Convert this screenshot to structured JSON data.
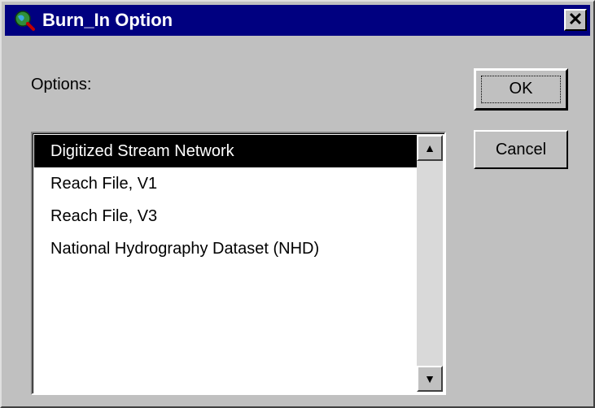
{
  "window": {
    "title": "Burn_In Option",
    "title_bar_color": "#000080",
    "icon": "globe-search-icon",
    "close_label": "✕"
  },
  "dialog": {
    "options_label": "Options:",
    "list": {
      "items": [
        {
          "label": "Digitized Stream Network",
          "selected": true
        },
        {
          "label": "Reach File, V1",
          "selected": false
        },
        {
          "label": "Reach File, V3",
          "selected": false
        },
        {
          "label": "National Hydrography Dataset (NHD)",
          "selected": false
        }
      ],
      "scroll_up_glyph": "▲",
      "scroll_down_glyph": "▼"
    },
    "buttons": {
      "ok_label": "OK",
      "cancel_label": "Cancel"
    }
  }
}
